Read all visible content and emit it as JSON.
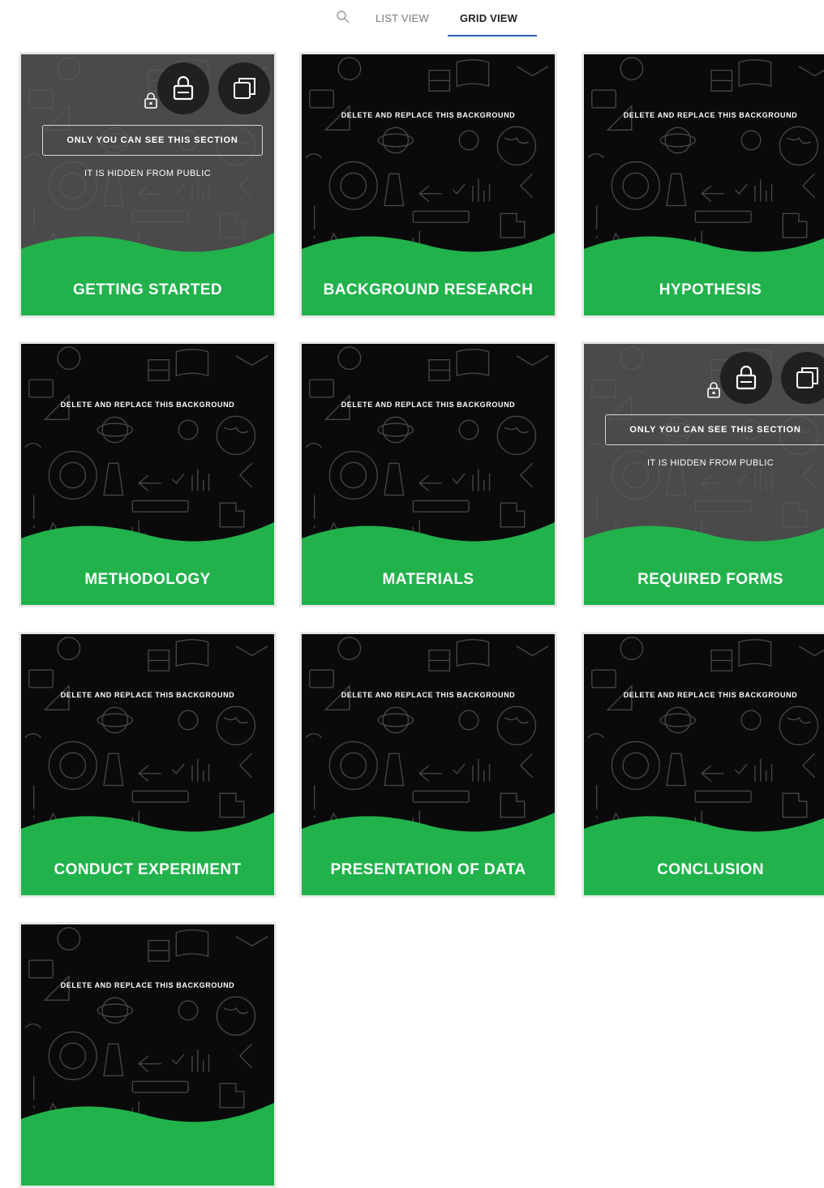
{
  "nav": {
    "list_view_label": "LIST VIEW",
    "grid_view_label": "GRID VIEW",
    "search_icon": "search-icon"
  },
  "colors": {
    "accent_green": "#22b24c",
    "card_dark": "#0a0a0a",
    "card_hidden": "#4a4a4a",
    "tab_underline": "#2a5fa8"
  },
  "card_bg_note": "DELETE AND REPLACE THIS BACKGROUND",
  "hidden_notice": {
    "title": "ONLY YOU CAN SEE THIS SECTION",
    "subtitle": "IT IS HIDDEN FROM PUBLIC"
  },
  "cards": [
    {
      "title": "GETTING STARTED",
      "hidden": true
    },
    {
      "title": "BACKGROUND RESEARCH",
      "hidden": false
    },
    {
      "title": "HYPOTHESIS",
      "hidden": false
    },
    {
      "title": "METHODOLOGY",
      "hidden": false
    },
    {
      "title": "MATERIALS",
      "hidden": false
    },
    {
      "title": "REQUIRED FORMS",
      "hidden": true
    },
    {
      "title": "CONDUCT EXPERIMENT",
      "hidden": false
    },
    {
      "title": "PRESENTATION OF DATA",
      "hidden": false
    },
    {
      "title": "CONCLUSION",
      "hidden": false
    },
    {
      "title": "",
      "hidden": false
    }
  ]
}
